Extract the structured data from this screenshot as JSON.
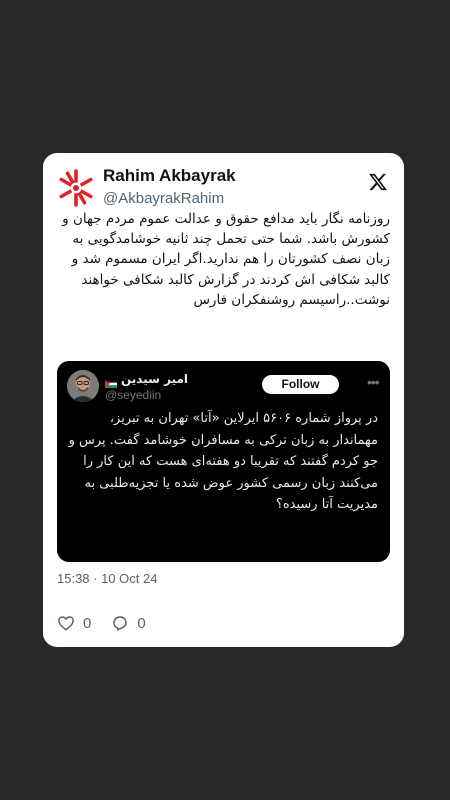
{
  "tweet": {
    "author": {
      "display_name": "Rahim Akbayrak",
      "handle": "@AkbayrakRahim",
      "avatar_icon": "red-asterisk-logo-icon",
      "avatar_color": "#e0202a"
    },
    "platform_icon": "x-logo-icon",
    "text": "روزنامه نگار باید مدافع حقوق و عدالت عموم  مردم جهان و کشورش باشد. شما حتی تحمل چند ثانیه خوشامدگویی به زبان نصف کشورتان را هم ندارید.اگر ایران مسموم شد و کالبد شکافی اش کردند در گزارش کالبد شکافی خواهند نوشت..راسیسم روشنفکران فارس",
    "timestamp": "15:38 · 10 Oct 24",
    "likes_count": "0",
    "replies_count": "0"
  },
  "quoted_tweet": {
    "author_name": "امیر سیدین",
    "author_handle": "@seyediin",
    "flag_icon": "palestine-flag-icon",
    "follow_label": "Follow",
    "more_icon": "more-options-icon",
    "text": "در پرواز شماره ۵۶۰۶ ایرلاین «آتا» تهران به تبریز، مهماندار به زبان ترکی به مسافران خوشامد گفت. پرس و جو کردم گفتند که تقریبا دو هفته‌ای هست که این کار را می‌کنند زبان رسمی کشور عوض شده یا تجزیه‌طلبی به مدیریت آتا رسیده؟"
  },
  "colors": {
    "background": "#282828",
    "card": "#ffffff",
    "quote_background": "#000000",
    "secondary_text": "#536471"
  }
}
